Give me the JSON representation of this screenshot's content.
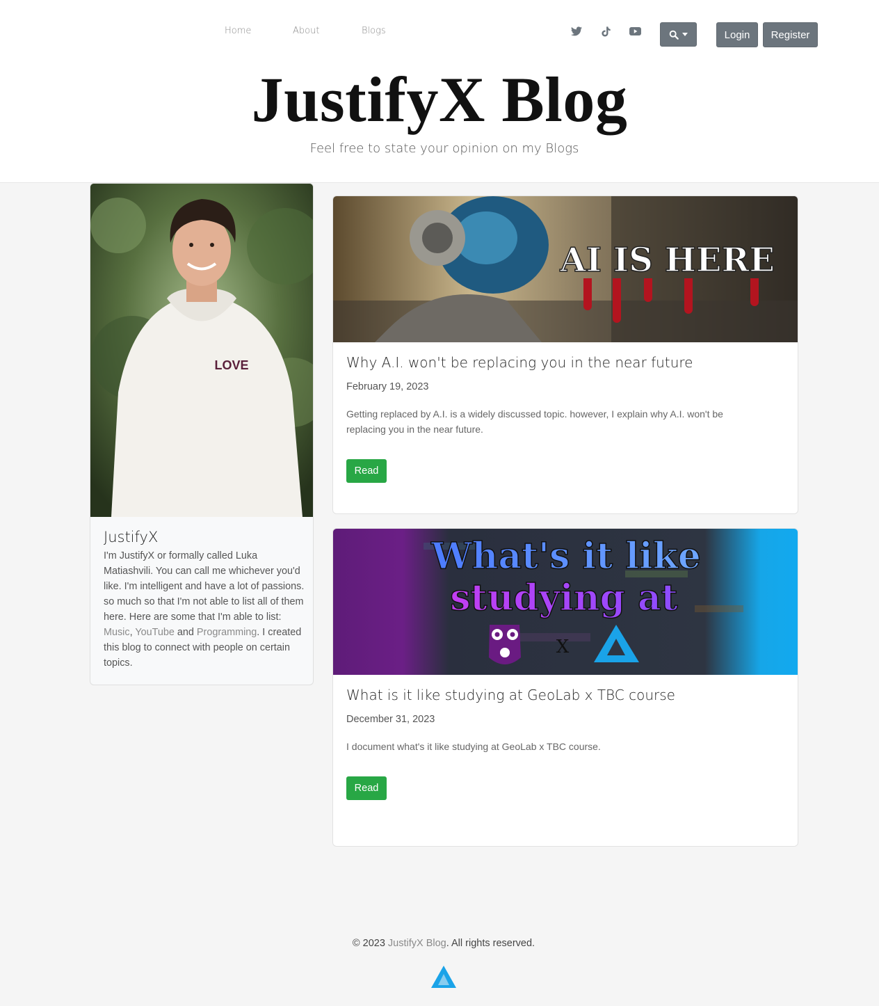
{
  "nav": {
    "links": [
      "Home",
      "About",
      "Blogs"
    ],
    "social": [
      "twitter-icon",
      "tiktok-icon",
      "youtube-icon"
    ],
    "login": "Login",
    "register": "Register",
    "search_icon": "search-icon"
  },
  "hero": {
    "title": "JustifyX Blog",
    "subtitle": "Feel free to state your opinion on my Blogs"
  },
  "profile": {
    "name": "JustifyX",
    "text_1": "I'm JustifyX or formally called Luka Matiashvili. You can call me whichever you'd like. I'm intelligent and have a lot of passions. so much so that I'm not able to list all of them here. Here are some that I'm able to list: ",
    "link_music": "Music",
    "sep_1": ", ",
    "link_youtube": "YouTube",
    "and": " and ",
    "link_programming": "Programming",
    "text_2": ". I created this blog to connect with people on certain topics.",
    "photo_badge": "LOVE"
  },
  "posts": [
    {
      "image_text": "AI IS HERE",
      "title": "Why A.I. won't be replacing you in the near future",
      "date": "February 19, 2023",
      "description": "Getting replaced by A.I. is a widely discussed topic. however, I explain why A.I. won't be replacing you in the near future.",
      "button": "Read"
    },
    {
      "image_text_1": "What's it like",
      "image_text_2": "studying at",
      "image_x": "X",
      "title": "What is it like studying at GeoLab x TBC course",
      "date": "December 31, 2023",
      "description": "I document what's it like studying at GeoLab x TBC course.",
      "button": "Read"
    }
  ],
  "footer": {
    "prefix": "© 2023 ",
    "link": "JustifyX Blog",
    "suffix": ". All rights reserved."
  },
  "colors": {
    "accent_green": "#28a745",
    "button_gray": "#6c757d",
    "background": "#f5f5f5",
    "tbc_blue": "#1aa3e8"
  }
}
